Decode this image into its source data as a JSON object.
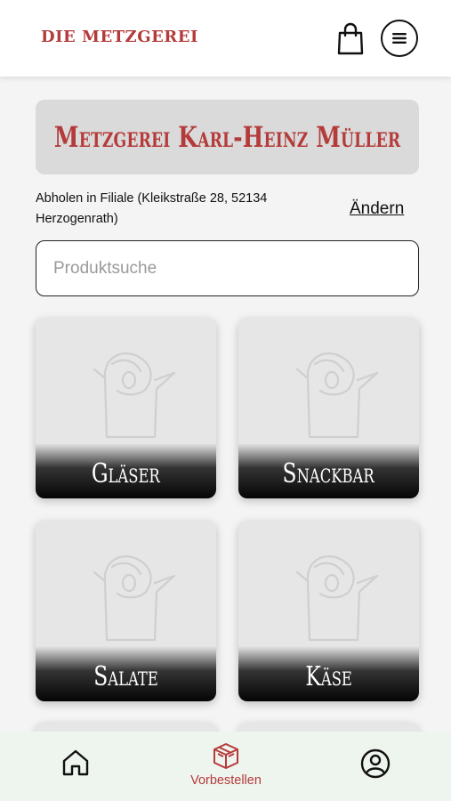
{
  "header": {
    "brand": "DIE METZGEREI",
    "cart_icon": "shopping-bag-icon",
    "menu_icon": "hamburger-menu-icon"
  },
  "shop": {
    "name": "Metzgerei Karl-Heinz Müller"
  },
  "pickup": {
    "text": "Abholen in Filiale (Kleikstraße 28, 52134 Herzogenrath)",
    "change_label": "Ändern"
  },
  "search": {
    "placeholder": "Produktsuche",
    "value": ""
  },
  "categories": [
    {
      "label": "Gläser"
    },
    {
      "label": "Snackbar"
    },
    {
      "label": "Salate"
    },
    {
      "label": "Käse"
    }
  ],
  "bottom_nav": {
    "home_icon": "home-icon",
    "order_icon": "box-icon",
    "order_label": "Vorbestellen",
    "profile_icon": "user-circle-icon"
  },
  "colors": {
    "brand_red": "#b53b3b",
    "banner_bg": "#dadada",
    "nav_bg": "#eef4ee",
    "page_bg": "#f4f4f4"
  }
}
